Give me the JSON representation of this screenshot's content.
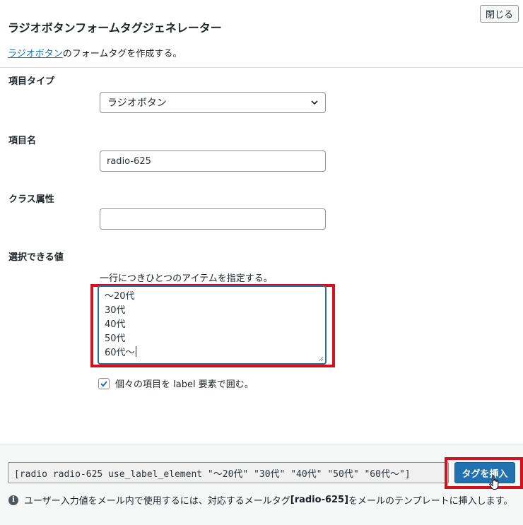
{
  "dialog": {
    "close_label": "閉じる",
    "title": "ラジオボタンフォームタグジェネレーター",
    "description_link": "ラジオボタン",
    "description_rest": "のフォームタグを作成する。"
  },
  "fields": {
    "type": {
      "label": "項目タイプ",
      "value": "ラジオボタン"
    },
    "name": {
      "label": "項目名",
      "value": "radio-625"
    },
    "class": {
      "label": "クラス属性",
      "value": ""
    },
    "options": {
      "label": "選択できる値",
      "hint": "一行につきひとつのアイテムを指定する。",
      "lines": [
        "〜20代",
        "30代",
        "40代",
        "50代",
        "60代〜"
      ]
    },
    "use_label": {
      "label": "個々の項目を label 要素で囲む。",
      "checked": true
    }
  },
  "footer": {
    "tag_output": "[radio radio-625 use_label_element \"〜20代\" \"30代\" \"40代\" \"50代\" \"60代〜\"]",
    "insert_label": "タグを挿入",
    "info_prefix": "ユーザー入力値をメール内で使用するには、対応するメールタグ ",
    "info_tag": "[radio-625]",
    "info_suffix": " をメールのテンプレートに挿入します。"
  },
  "colors": {
    "accent": "#2271b1",
    "highlight": "#d4121f"
  }
}
